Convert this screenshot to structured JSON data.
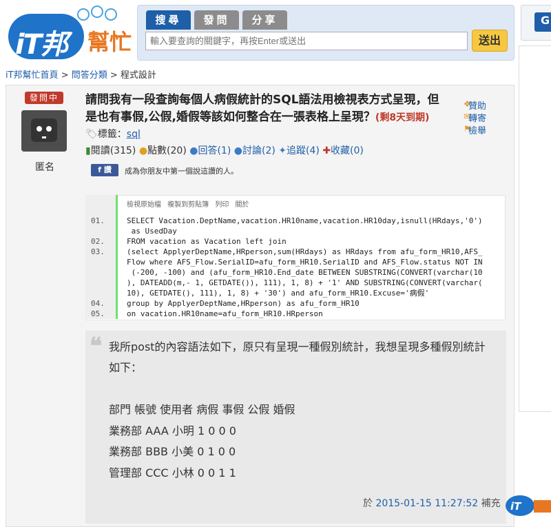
{
  "header": {
    "logo_it": "iT邦",
    "logo_help": "幫忙",
    "tabs": [
      "搜尋",
      "發問",
      "分享"
    ],
    "search_placeholder": "輸入要查詢的關鍵字，再按Enter或送出",
    "submit_label": "送出",
    "right_button": "G"
  },
  "breadcrumb": {
    "home": "iT邦幫忙首頁",
    "sep1": " > ",
    "category": "問答分類",
    "sep2": " > ",
    "current": "程式設計"
  },
  "question": {
    "status": "發問中",
    "author": "匿名",
    "title": "請問我有一段查詢每個人病假統計的SQL語法用檢視表方式呈現，但是也有事假,公假,婚假等該如何整合在一張表格上呈現？",
    "deadline": "(剩8天到期)",
    "side_actions": [
      "贊助",
      "轉寄",
      "檢舉"
    ],
    "tags_label": "標籤：",
    "tag": "sql",
    "stats": {
      "views": "閱讀(315)",
      "points": "點數(20)",
      "answers": "回答(1)",
      "discuss": "討論(2)",
      "follow": "追蹤(4)",
      "collect": "收藏(0)"
    },
    "fb_like": "讚",
    "fb_text": "成為你朋友中第一個說這讚的人。"
  },
  "code": {
    "toolbar": "檢視原始檔 複製到剪貼簿 列印 關於",
    "lines": [
      {
        "num": "01.",
        "text": "SELECT Vacation.DeptName,vacation.HR10name,vacation.HR10day,isnull(HRdays,'0')\n as UsedDay"
      },
      {
        "num": "02.",
        "text": "FROM vacation as Vacation left join"
      },
      {
        "num": "03.",
        "text": "(select ApplyerDeptName,HRperson,sum(HRdays) as HRdays from afu_form_HR10,AFS_\nFlow where AFS_Flow.SerialID=afu_form_HR10.SerialID and AFS_Flow.status NOT IN\n (-200, -100) and (afu_form_HR10.End_date BETWEEN SUBSTRING(CONVERT(varchar(10\n), DATEADD(m,- 1, GETDATE()), 111), 1, 8) + '1' AND SUBSTRING(CONVERT(varchar(\n10), GETDATE(), 111), 1, 8) + '30') and afu_form_HR10.Excuse='病假'"
      },
      {
        "num": "04.",
        "text": "group by ApplyerDeptName,HRperson) as afu_form_HR10"
      },
      {
        "num": "05.",
        "text": "on vacation.HR10name=afu_form_HR10.HRperson"
      }
    ]
  },
  "quote": {
    "line1": "我所post的內容語法如下，原只有呈現一種假別統計，我想呈現多種假別統計",
    "line2": "如下：",
    "table_header": "部門 帳號 使用者 病假 事假 公假 婚假",
    "rows": [
      "業務部 AAA 小明 1 0 0 0",
      "業務部 BBB 小美 0 1 0 0",
      "管理部 CCC 小林 0 0 1 1"
    ],
    "time_prefix": "於 ",
    "time": "2015-01-15 11:27:52",
    "time_suffix": " 補充"
  },
  "colors": {
    "brand_blue": "#1f5ea8",
    "brand_orange": "#e87722",
    "status_red": "#c0392b"
  }
}
